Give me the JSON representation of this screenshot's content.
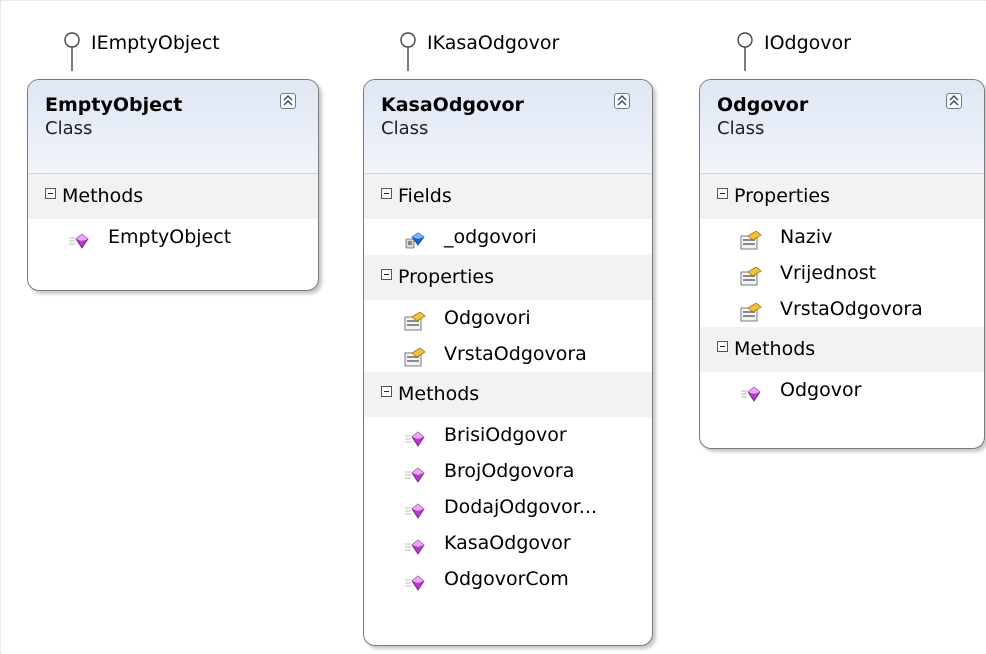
{
  "interfaces": [
    {
      "label": "IEmptyObject"
    },
    {
      "label": "IKasaOdgovor"
    },
    {
      "label": "IOdgovor"
    }
  ],
  "classes": [
    {
      "name": "EmptyObject",
      "stereotype": "Class",
      "compartments": [
        {
          "title": "Methods",
          "kind": "method",
          "members": [
            "EmptyObject"
          ]
        }
      ]
    },
    {
      "name": "KasaOdgovor",
      "stereotype": "Class",
      "compartments": [
        {
          "title": "Fields",
          "kind": "field",
          "members": [
            "_odgovori"
          ]
        },
        {
          "title": "Properties",
          "kind": "property",
          "members": [
            "Odgovori",
            "VrstaOdgovora"
          ]
        },
        {
          "title": "Methods",
          "kind": "method",
          "members": [
            "BrisiOdgovor",
            "BrojOdgovora",
            "DodajOdgovor...",
            "KasaOdgovor",
            "OdgovorCom"
          ]
        }
      ]
    },
    {
      "name": "Odgovor",
      "stereotype": "Class",
      "compartments": [
        {
          "title": "Properties",
          "kind": "property",
          "members": [
            "Naziv",
            "Vrijednost",
            "VrstaOdgovora"
          ]
        },
        {
          "title": "Methods",
          "kind": "method",
          "members": [
            "Odgovor"
          ]
        }
      ]
    }
  ],
  "icons": {
    "method": "method-icon",
    "field": "field-icon",
    "property": "property-icon",
    "collapse": "collapse-chevron-icon",
    "toggle": "compartment-collapse-icon",
    "interface": "interface-lollipop-icon"
  }
}
